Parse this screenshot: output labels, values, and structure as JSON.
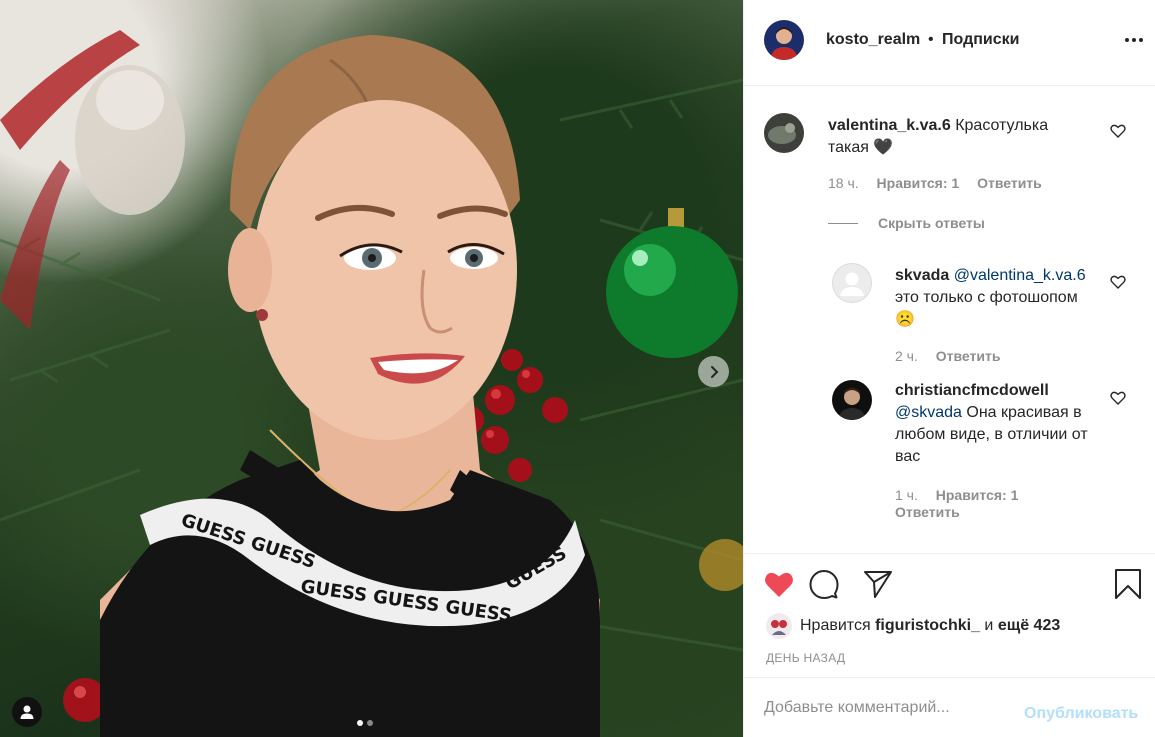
{
  "post": {
    "author": "kosto_realm",
    "separator": "•",
    "follow_state": "Подписки",
    "images_count": 2,
    "current_image": 1
  },
  "comments": [
    {
      "user": "valentina_k.va.6",
      "mention": "",
      "text": "Красотулька такая 🖤",
      "time": "18 ч.",
      "likes_label": "Нравится: 1",
      "reply_label": "Ответить"
    }
  ],
  "hide_replies_label": "Скрыть ответы",
  "replies": [
    {
      "user": "skvada",
      "mention": "@valentina_k.va.6",
      "text": "это только с фотошопом☹️",
      "time": "2 ч.",
      "likes_label": "",
      "reply_label": "Ответить"
    },
    {
      "user": "christiancfmcdowell",
      "mention": "@skvada",
      "text": "Она красивая в любом виде, в отличии от вас",
      "time": "1 ч.",
      "likes_label": "Нравится: 1",
      "reply_label": "Ответить"
    }
  ],
  "likes": {
    "prefix": "Нравится",
    "user": "figuristochki_",
    "joiner": "и",
    "others": "ещё 423"
  },
  "posted_ago": "ДЕНЬ НАЗАД",
  "add_comment": {
    "placeholder": "Добавьте комментарий...",
    "post_label": "Опубликовать"
  },
  "icons": {
    "like": "heart-filled-icon",
    "comment": "comment-icon",
    "share": "paper-plane-icon",
    "save": "bookmark-icon",
    "more": "more-horizontal-icon",
    "next": "chevron-right-icon",
    "tag": "user-tag-icon"
  },
  "colors": {
    "like_red": "#ed4956",
    "link_blue": "#00376b",
    "post_button_disabled": "#b2dffc",
    "muted_text": "#8e8e8e"
  }
}
